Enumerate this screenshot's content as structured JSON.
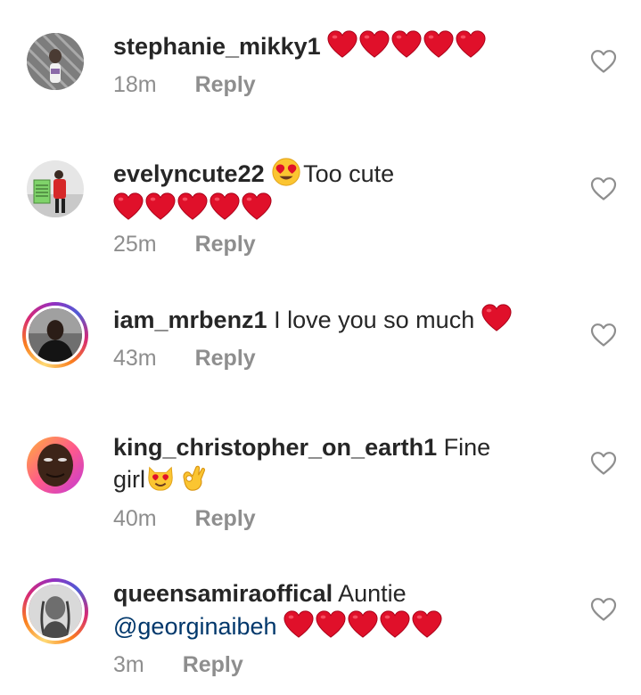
{
  "comments": [
    {
      "username": "stephanie_mikky1",
      "text": "",
      "emoji_hearts": 5,
      "time": "18m",
      "reply": "Reply"
    },
    {
      "username": "evelyncute22",
      "text": "Too cute",
      "line2_hearts": 5,
      "time": "25m",
      "reply": "Reply"
    },
    {
      "username": "iam_mrbenz1",
      "text": "I love you so much",
      "time": "43m",
      "reply": "Reply"
    },
    {
      "username": "king_christopher_on_earth1",
      "text": "Fine",
      "text2": "girl",
      "time": "40m",
      "reply": "Reply"
    },
    {
      "username": "queensamiraoffical",
      "text": "Auntie",
      "mention": "@georginaibeh",
      "time": "3m",
      "reply": "Reply"
    }
  ],
  "icons": {
    "like": "heart-outline-icon",
    "heart_emoji": "red-heart-emoji",
    "heart_eyes": "heart-eyes-emoji",
    "heart_eyes_cat": "heart-eyes-cat-emoji",
    "ok_hand": "ok-hand-emoji"
  },
  "colors": {
    "username": "#262626",
    "meta": "#8e8e8e",
    "mention": "#00376b",
    "heart": "#e0102a"
  }
}
